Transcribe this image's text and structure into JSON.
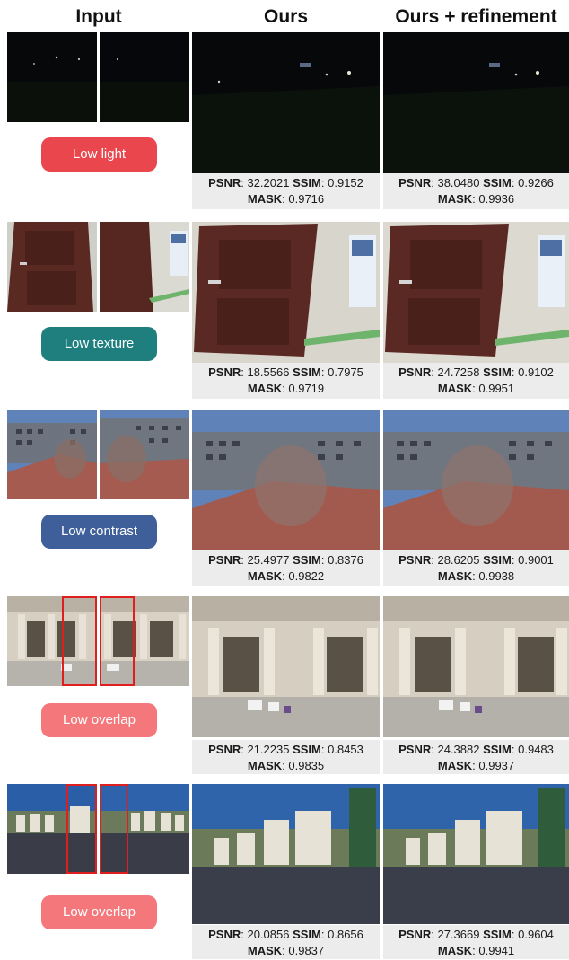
{
  "headers": {
    "input": "Input",
    "ours": "Ours",
    "ours_refine": "Ours + refinement"
  },
  "metric_labels": {
    "psnr": "PSNR",
    "ssim": "SSIM",
    "mask": "MASK"
  },
  "rows": [
    {
      "tag": "Low light",
      "tag_color": "#e9474d",
      "ours": {
        "psnr": "32.2021",
        "ssim": "0.9152",
        "mask": "0.9716"
      },
      "refine": {
        "psnr": "38.0480",
        "ssim": "0.9266",
        "mask": "0.9936"
      }
    },
    {
      "tag": "Low texture",
      "tag_color": "#1f7f7f",
      "ours": {
        "psnr": "18.5566",
        "ssim": "0.7975",
        "mask": "0.9719"
      },
      "refine": {
        "psnr": "24.7258",
        "ssim": "0.9102",
        "mask": "0.9951"
      }
    },
    {
      "tag": "Low contrast",
      "tag_color": "#3e5f9a",
      "ours": {
        "psnr": "25.4977",
        "ssim": "0.8376",
        "mask": "0.9822"
      },
      "refine": {
        "psnr": "28.6205",
        "ssim": "0.9001",
        "mask": "0.9938"
      }
    },
    {
      "tag": "Low overlap",
      "tag_color": "#f4787b",
      "ours": {
        "psnr": "21.2235",
        "ssim": "0.8453",
        "mask": "0.9835"
      },
      "refine": {
        "psnr": "24.3882",
        "ssim": "0.9483",
        "mask": "0.9937"
      }
    },
    {
      "tag": "Low overlap",
      "tag_color": "#f4787b",
      "ours": {
        "psnr": "20.0856",
        "ssim": "0.8656",
        "mask": "0.9837"
      },
      "refine": {
        "psnr": "27.3669",
        "ssim": "0.9604",
        "mask": "0.9941"
      }
    }
  ]
}
